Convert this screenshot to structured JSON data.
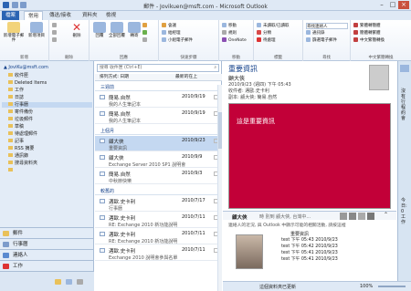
{
  "window": {
    "title": "郵件 - Jovikuen@msft.com - Microsoft Outlook"
  },
  "tabs": [
    "檔案",
    "常用",
    "傳送/接收",
    "資料夾",
    "檢視"
  ],
  "ribbon": {
    "new_email": "新增電子郵件",
    "new_items": "新增項目",
    "delete": "刪除",
    "reply": "回覆",
    "reply_all": "全部回覆",
    "forward": "轉寄",
    "meeting": "會議",
    "im": "立即訊息",
    "more": "其他",
    "to_manager": "給經理",
    "team_email": "小組電子郵件",
    "move": "移動",
    "rules": "規則",
    "onenote": "OneNote",
    "unread_read": "未讀取/已讀取",
    "categorize": "分類",
    "follow_up": "待處理",
    "find_contact": "尋找連絡人",
    "address_book": "通訊錄",
    "filter_email": "篩選電子郵件",
    "simplified": "繁體轉簡體",
    "traditional": "簡體轉繁體",
    "chinese_conv": "中文繁簡轉換",
    "groups": [
      "新增",
      "刪除",
      "回應",
      "快速步驟",
      "移動",
      "標籤",
      "尋找",
      "中文繁簡轉換"
    ]
  },
  "nav": {
    "account": "▲ JoviKu@msft.com",
    "folders": [
      "收件匣",
      "Deleted Items",
      "工作",
      "日誌",
      "行事曆",
      "寄件備份",
      "垃圾郵件",
      "草稿",
      "待處理郵件",
      "記事",
      "RSS 摘要",
      "通訊錄",
      "搜尋資料夾"
    ],
    "buttons": [
      "郵件",
      "行事曆",
      "連絡人",
      "工作"
    ]
  },
  "list": {
    "search_placeholder": "搜尋 收件匣 (Ctrl+E)",
    "col_sort": "排列方式: 日期",
    "col_order": "最新的在上",
    "groups": [
      "三週前",
      "上個月",
      "較舊的"
    ],
    "messages": [
      {
        "from": "簡易.自然",
        "date": "2010/9/19",
        "subject": "我的人生筆記本"
      },
      {
        "from": "簡易.自然",
        "date": "2010/9/19",
        "subject": "我的人生筆記本"
      },
      {
        "from": "顧大俠",
        "date": "2010/9/23",
        "subject": "重要資訊"
      },
      {
        "from": "顧大俠",
        "date": "2010/9/9",
        "subject": "Exchange Server 2010 SP1 說明會"
      },
      {
        "from": "簡易.自然",
        "date": "2010/9/3",
        "subject": "中秋節快樂"
      },
      {
        "from": "邁歐.史卡利",
        "date": "2010/7/17",
        "subject": "行事曆"
      },
      {
        "from": "邁歐.史卡利",
        "date": "2010/7/11",
        "subject": "RE: Exchange 2010 新功能說明"
      },
      {
        "from": "邁歐.史卡利",
        "date": "2010/7/11",
        "subject": "RE: Exchange 2010 新功能說明"
      },
      {
        "from": "邁歐.史卡利",
        "date": "2010/7/11",
        "subject": "Exchange 2010 說明會參與名單"
      }
    ]
  },
  "reading": {
    "subject": "重要資訊",
    "from": "顧大俠",
    "time": "2010/9/23 (週四) 下午 05:43",
    "to_label": "收件者:",
    "to": "邁歐.史卡利",
    "cc_label": "副本:",
    "cc": "顧大俠; 簡易.自然",
    "body_text": "這是重要資訊",
    "body_color": "#c20038",
    "social_name": "顧大俠",
    "social_hint": "時 別到 顧大俠, 台灣中...",
    "social_note": "連絡人的近況, 與 Outlook 中顯示可能的相關活動, 請按這裡",
    "activity_title": "重要資訊",
    "activity": [
      {
        "label": "test",
        "date": "下午 05:43 2010/9/23"
      },
      {
        "label": "test",
        "date": "下午 05:42 2010/9/23"
      },
      {
        "label": "test",
        "date": "下午 05:41 2010/9/23"
      },
      {
        "label": "test",
        "date": "下午 05:41 2010/9/23"
      }
    ]
  },
  "todo": {
    "no_appt": "沒有行程約會",
    "tasks": "今日: 0 工作"
  },
  "status": {
    "zoom": "100%",
    "folder_status": "這個資料夾已更新"
  }
}
